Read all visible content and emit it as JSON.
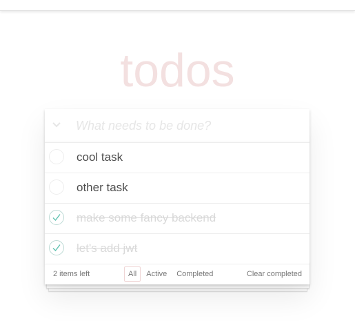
{
  "app": {
    "title": "todos"
  },
  "new_todo": {
    "placeholder": "What needs to be done?",
    "value": ""
  },
  "toggle_all": {
    "icon": "chevron-down-icon",
    "glyph": "⌄"
  },
  "todos": [
    {
      "label": "cool task",
      "completed": false
    },
    {
      "label": "other task",
      "completed": false
    },
    {
      "label": "make some fancy backend",
      "completed": true
    },
    {
      "label": "let's add jwt",
      "completed": true
    }
  ],
  "footer": {
    "count_text": "2 items left",
    "filters": [
      "All",
      "Active",
      "Completed"
    ],
    "selected_filter": "All",
    "clear_label": "Clear completed"
  },
  "colors": {
    "title": "#af2f2f",
    "check_mark": "#5dc2af",
    "completed_text": "#d9d9d9",
    "text": "#4d4d4d"
  }
}
